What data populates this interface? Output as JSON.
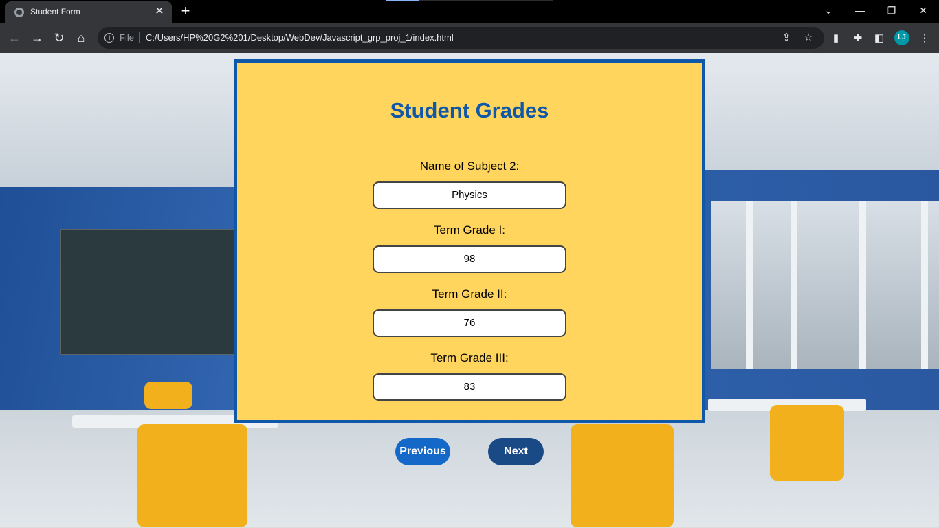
{
  "browser": {
    "tab_title": "Student Form",
    "tab_close": "✕",
    "new_tab": "+",
    "scheme_label": "File",
    "url": "C:/Users/HP%20G2%201/Desktop/WebDev/Javascript_grp_proj_1/index.html",
    "profile_initials": "LJ",
    "window_controls": {
      "dropdown": "⌄",
      "minimize": "—",
      "restore": "❐",
      "close": "✕"
    },
    "nav": {
      "back": "←",
      "forward": "→",
      "reload": "↻",
      "home": "⌂",
      "menu": "⋮"
    }
  },
  "form": {
    "title": "Student Grades",
    "fields": [
      {
        "label": "Name of Subject 2:",
        "value": "Physics"
      },
      {
        "label": "Term Grade I:",
        "value": "98"
      },
      {
        "label": "Term Grade II:",
        "value": "76"
      },
      {
        "label": "Term Grade III:",
        "value": "83"
      }
    ],
    "previous_label": "Previous",
    "next_label": "Next"
  },
  "colors": {
    "card_bg": "#ffd55e",
    "card_border": "#0f57a8",
    "title_color": "#0f57a8",
    "previous_button": "#1368c8",
    "next_button": "#1a4a86"
  }
}
